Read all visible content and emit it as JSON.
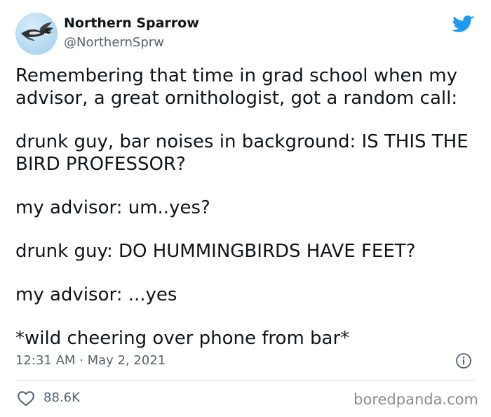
{
  "author": {
    "name": "Northern Sparrow",
    "handle": "@NorthernSprw"
  },
  "tweet": {
    "paragraphs": [
      "Remembering that time in grad school when my",
      "advisor, a great ornithologist, got a random call:",
      "drunk guy, bar noises in background: IS THIS THE",
      "BIRD PROFESSOR?",
      "my advisor: um..yes?",
      "drunk guy: DO HUMMINGBIRDS HAVE FEET?",
      "my advisor: ...yes",
      "*wild cheering over phone from bar*"
    ]
  },
  "meta": {
    "timestamp": "12:31 AM · May 2, 2021"
  },
  "engagement": {
    "likes": "88.6K"
  },
  "watermark": "boredpanda.com",
  "colors": {
    "twitter_blue": "#1d9bf0",
    "secondary_text": "#536471",
    "divider": "#cfd9de"
  },
  "icons": {
    "brand": "twitter-bird-icon",
    "info": "info-icon",
    "like": "heart-icon"
  }
}
